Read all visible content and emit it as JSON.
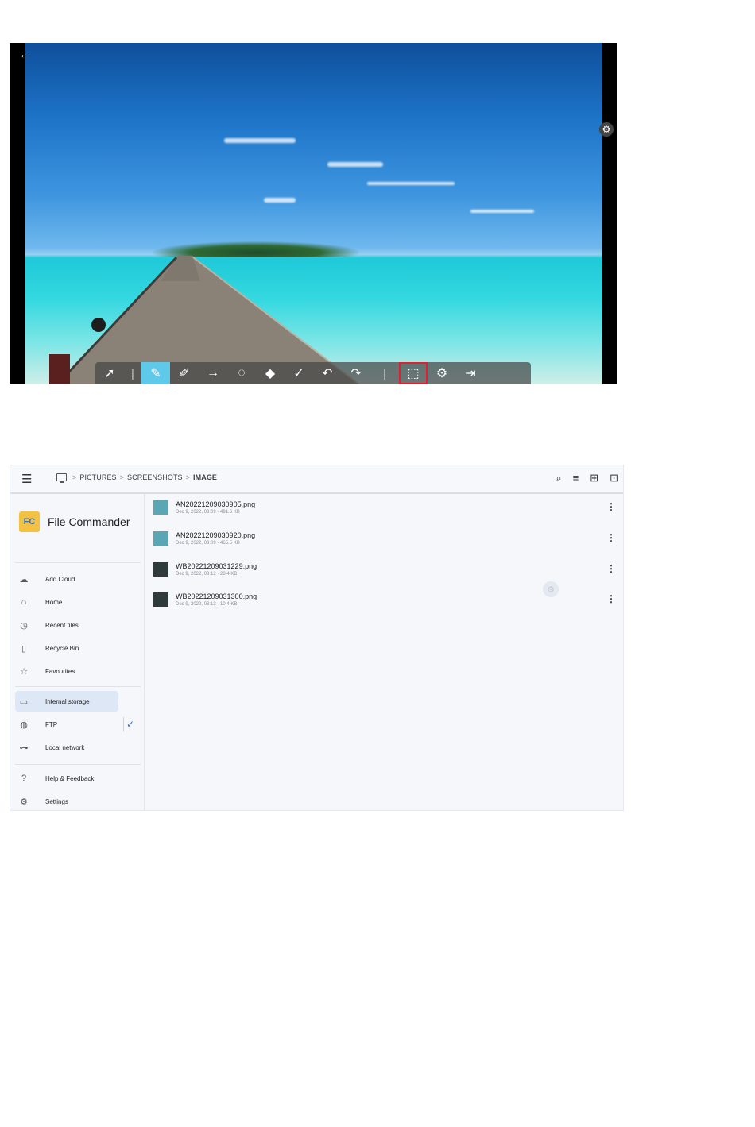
{
  "overlay": {
    "back_icon": "arrow-left-icon",
    "settings_float_icon": "gear-icon",
    "toolbar": {
      "tools": [
        {
          "name": "select-tool",
          "icon": "cursor-icon",
          "glyph": "➚"
        },
        {
          "name": "pen-tool",
          "icon": "pen-icon",
          "glyph": "✎",
          "active": true
        },
        {
          "name": "highlighter-tool",
          "icon": "highlighter-icon",
          "glyph": "✐"
        },
        {
          "name": "arrow-tool",
          "icon": "arrow-right-icon",
          "glyph": "→"
        },
        {
          "name": "lasso-tool",
          "icon": "lasso-icon",
          "glyph": "◌"
        },
        {
          "name": "eraser-tool",
          "icon": "eraser-icon",
          "glyph": "◆"
        },
        {
          "name": "clear-tool",
          "icon": "broom-icon",
          "glyph": "✓"
        },
        {
          "name": "undo-tool",
          "icon": "undo-icon",
          "glyph": "↶"
        },
        {
          "name": "redo-tool",
          "icon": "redo-icon",
          "glyph": "↷"
        },
        {
          "name": "screenshot-tool",
          "icon": "screen-capture-icon",
          "glyph": "⬚",
          "highlighted": true
        },
        {
          "name": "settings-tool",
          "icon": "gear-icon",
          "glyph": "⚙"
        },
        {
          "name": "exit-tool",
          "icon": "exit-icon",
          "glyph": "⇥"
        }
      ],
      "highlight_color": "#e0202a",
      "active_color": "#5ec9e8"
    }
  },
  "file_commander": {
    "breadcrumb": {
      "items": [
        "PICTURES",
        "SCREENSHOTS",
        "IMAGE"
      ],
      "separator": ">"
    },
    "actions": [
      {
        "name": "search-button",
        "icon": "search-icon",
        "glyph": "⌕"
      },
      {
        "name": "sort-button",
        "icon": "sort-icon",
        "glyph": "≡"
      },
      {
        "name": "new-file-button",
        "icon": "new-file-icon",
        "glyph": "⊞"
      },
      {
        "name": "new-folder-button",
        "icon": "new-folder-icon",
        "glyph": "⊡"
      }
    ],
    "brand": {
      "logo_text": "FC",
      "name": "File Commander"
    },
    "nav": {
      "add_cloud": "Add Cloud",
      "home": "Home",
      "recent_files": "Recent files",
      "recycle_bin": "Recycle Bin",
      "favourites": "Favourites",
      "internal_storage": "Internal storage",
      "ftp": "FTP",
      "local_network": "Local network",
      "help_feedback": "Help & Feedback",
      "settings": "Settings"
    },
    "files": [
      {
        "name": "AN20221209030905.png",
        "meta": "Dec 9, 2022, 03:09 · 491.6 KB",
        "thumb": "#5aa6b4"
      },
      {
        "name": "AN20221209030920.png",
        "meta": "Dec 9, 2022, 03:09 · 465.5 KB",
        "thumb": "#5aa6b4"
      },
      {
        "name": "WB20221209031229.png",
        "meta": "Dec 9, 2022, 03:12 · 23.4 KB",
        "thumb": "#2f3b39"
      },
      {
        "name": "WB20221209031300.png",
        "meta": "Dec 9, 2022, 03:13 · 10.4 KB",
        "thumb": "#2f3b39"
      }
    ],
    "accent_color": "#2a6fd6",
    "brand_color": "#f4c242"
  }
}
